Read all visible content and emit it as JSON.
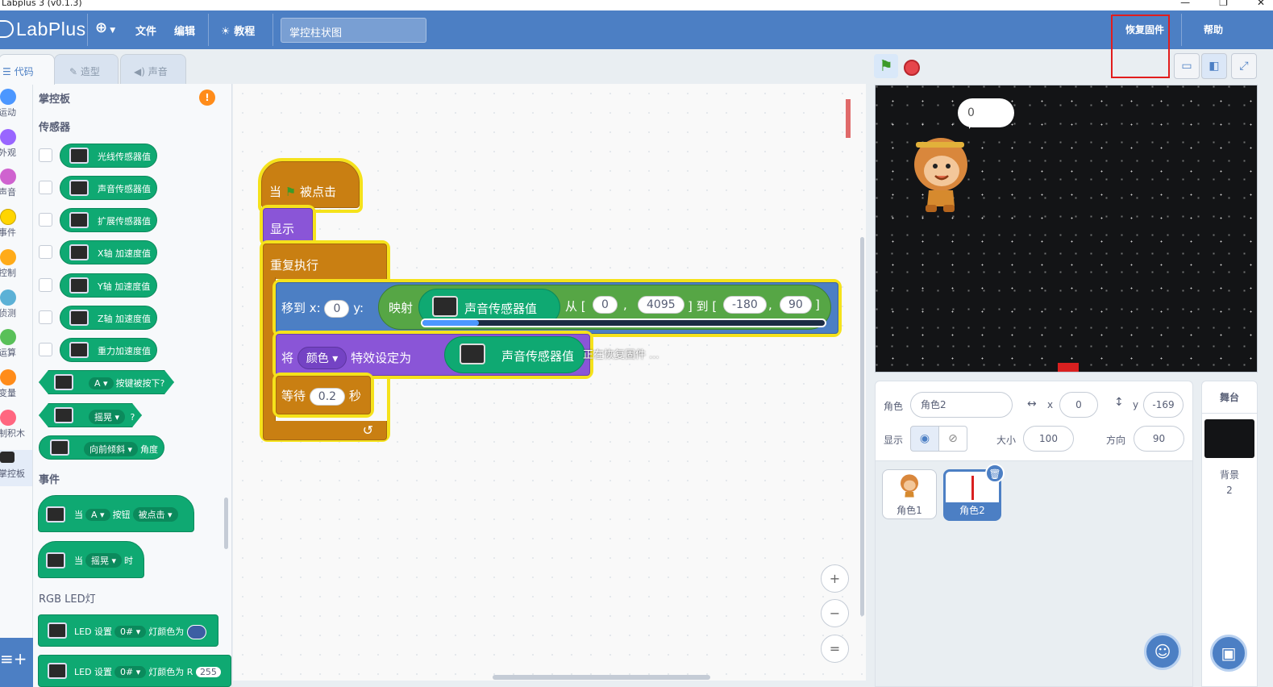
{
  "window": {
    "title": "Labplus 3 (v0.1.3)",
    "controls": [
      "—",
      "❐",
      "✕"
    ]
  },
  "menubar": {
    "logo": "LabPlus",
    "language_icon": "globe-icon",
    "file": "文件",
    "edit": "编辑",
    "tutorial": "教程",
    "project_name": "掌控柱状图",
    "restore_firmware": "恢复固件",
    "help": "帮助"
  },
  "tabs": [
    {
      "label": "代码",
      "active": true,
      "icon": "code-icon"
    },
    {
      "label": "造型",
      "active": false,
      "icon": "brush-icon"
    },
    {
      "label": "声音",
      "active": false,
      "icon": "speaker-icon"
    }
  ],
  "categories": [
    {
      "label": "运动",
      "color": "#4c97ff"
    },
    {
      "label": "外观",
      "color": "#9966ff"
    },
    {
      "label": "声音",
      "color": "#cf63cf"
    },
    {
      "label": "事件",
      "color": "#ffd500"
    },
    {
      "label": "控制",
      "color": "#ffab19"
    },
    {
      "label": "侦测",
      "color": "#5cb1d6"
    },
    {
      "label": "运算",
      "color": "#59c059"
    },
    {
      "label": "变量",
      "color": "#ff8c1a"
    },
    {
      "label": "制积木",
      "color": "#ff6680"
    },
    {
      "label": "掌控板",
      "color": "#0fa972"
    }
  ],
  "palette": {
    "device_title": "掌控板",
    "sensors_title": "传感器",
    "sensors": [
      "光线传感器值",
      "声音传感器值",
      "扩展传感器值",
      "X轴 加速度值",
      "Y轴 加速度值",
      "Z轴 加速度值",
      "重力加速度值"
    ],
    "button_pressed": {
      "option": "A",
      "text": "按键被按下?"
    },
    "shake": {
      "option": "摇晃",
      "text": "?"
    },
    "tilt": {
      "option": "向前倾斜",
      "text": "角度"
    },
    "events_title": "事件",
    "when_button": {
      "prefix": "当",
      "option": "A",
      "mid": "按钮",
      "option2": "被点击"
    },
    "when_shake": {
      "prefix": "当",
      "option": "摇晃",
      "suffix": "时"
    },
    "rgb_title": "RGB LED灯",
    "led_set_color": {
      "text": "LED 设置",
      "option": "0#",
      "suffix": "灯颜色为"
    },
    "led_set_rgb": {
      "text": "LED 设置",
      "option": "0#",
      "suffix": "灯颜色为 R",
      "value": "255"
    }
  },
  "script": {
    "when_flag": {
      "prefix": "当",
      "suffix": "被点击"
    },
    "show": "显示",
    "forever": "重复执行",
    "goto": {
      "label": "移到 x:",
      "x": "0",
      "ylabel": "y:"
    },
    "map": {
      "label": "映射",
      "sensor": "声音传感器值",
      "from": "从 [",
      "a": "0",
      "b": "4095",
      "to": "] 到 [",
      "c": "-180",
      "d": "90",
      "end": "]"
    },
    "effect": {
      "label": "将",
      "option": "颜色",
      "mid": "特效设定为",
      "sensor": "声音传感器值"
    },
    "wait": {
      "label": "等待",
      "value": "0.2",
      "unit": "秒"
    }
  },
  "restore_progress": {
    "text": "正在恢复固件 ...",
    "fraction": 0.14
  },
  "zoom": {
    "in": "+",
    "out": "−",
    "reset": "="
  },
  "stage": {
    "bubble": "0"
  },
  "sprite_info": {
    "sprite_label": "角色",
    "sprite_name": "角色2",
    "x_label": "x",
    "x": "0",
    "y_label": "y",
    "y": "-169",
    "show_label": "显示",
    "size_label": "大小",
    "size": "100",
    "direction_label": "方向",
    "direction": "90"
  },
  "sprites": [
    {
      "name": "角色1",
      "selected": false
    },
    {
      "name": "角色2",
      "selected": true
    }
  ],
  "stage_panel": {
    "title": "舞台",
    "backdrop_label": "背景",
    "backdrop_count": "2"
  }
}
